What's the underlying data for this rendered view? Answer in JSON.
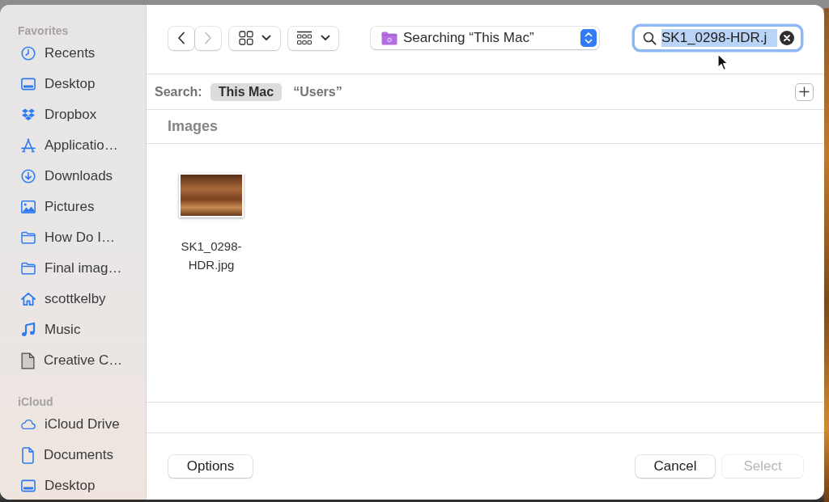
{
  "sidebar": {
    "sections": [
      {
        "title": "Favorites",
        "items": [
          {
            "label": "Recents",
            "selected": false
          },
          {
            "label": "Desktop",
            "selected": false
          },
          {
            "label": "Dropbox",
            "selected": false
          },
          {
            "label": "Applicatio…",
            "selected": false
          },
          {
            "label": "Downloads",
            "selected": false
          },
          {
            "label": "Pictures",
            "selected": false
          },
          {
            "label": "How Do I…",
            "selected": false
          },
          {
            "label": "Final imag…",
            "selected": false
          },
          {
            "label": "scottkelby",
            "selected": false
          },
          {
            "label": "Music",
            "selected": false
          },
          {
            "label": "Creative C…",
            "selected": false
          }
        ]
      },
      {
        "title": "iCloud",
        "items": [
          {
            "label": "iCloud Drive",
            "selected": false
          },
          {
            "label": "Documents",
            "selected": false
          },
          {
            "label": "Desktop",
            "selected": false
          }
        ]
      }
    ]
  },
  "toolbar": {
    "back": {
      "disabled": false
    },
    "forward": {
      "disabled": true
    },
    "location": {
      "label": "Searching “This Mac”"
    },
    "search": {
      "value": "SK1_0298-HDR.j",
      "focused": true,
      "text_selected": true
    }
  },
  "scope_bar": {
    "label": "Search:",
    "scopes": [
      {
        "label": "This Mac",
        "selected": true
      },
      {
        "label": "“Users”",
        "selected": false
      }
    ]
  },
  "results": {
    "section_title": "Images",
    "files": [
      {
        "name": "SK1_0298-HDR.jpg",
        "selected": false
      }
    ]
  },
  "footer": {
    "left_buttons": [
      {
        "label": "Options",
        "disabled": false
      }
    ],
    "right_buttons": [
      {
        "label": "Cancel",
        "disabled": false
      },
      {
        "label": "Select",
        "disabled": true
      }
    ]
  }
}
